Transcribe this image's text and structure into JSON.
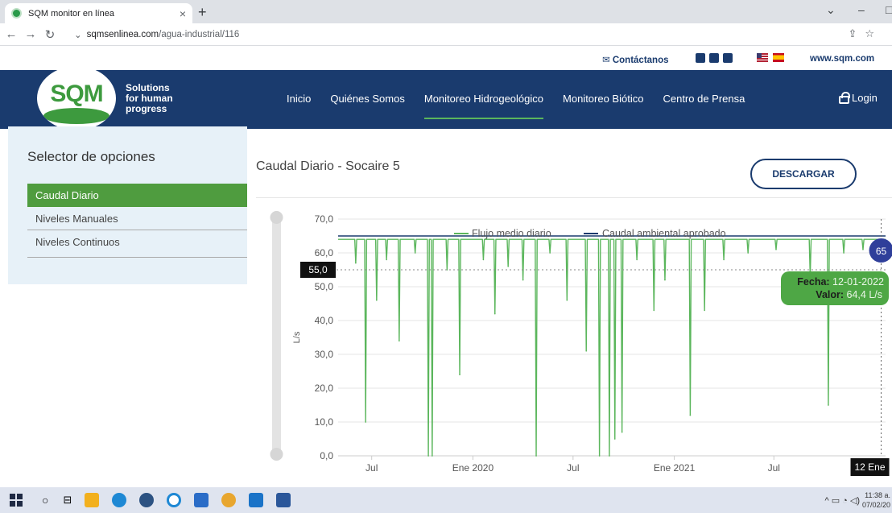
{
  "browser": {
    "tab_title": "SQM monitor en línea",
    "close_glyph": "×",
    "new_tab_glyph": "+",
    "url_host": "sqmsenlinea.com",
    "url_path": "/agua-industrial/116"
  },
  "topbar": {
    "contact": "Contáctanos",
    "website": "www.sqm.com"
  },
  "header": {
    "logo_text": "SQM",
    "tagline_1": "Solutions",
    "tagline_2": "for human",
    "tagline_3": "progress",
    "nav": [
      "Inicio",
      "Quiénes Somos",
      "Monitoreo Hidrogeológico",
      "Monitoreo Biótico",
      "Centro de Prensa"
    ],
    "login": "Login"
  },
  "sidebar": {
    "title": "Selector de opciones",
    "items": [
      "Caudal Diario",
      "Niveles Manuales",
      "Niveles Continuos"
    ]
  },
  "content": {
    "chart_title": "Caudal Diario - Socaire 5",
    "download_label": "DESCARGAR"
  },
  "chart_data": {
    "type": "line",
    "ylabel": "L/s",
    "y_ticks": [
      "70,0",
      "60,0",
      "50,0",
      "40,0",
      "30,0",
      "20,0",
      "10,0",
      "0,0"
    ],
    "ylim": [
      0,
      70
    ],
    "x_ticks": [
      "Jul",
      "Ene 2020",
      "Jul",
      "Ene 2021",
      "Jul"
    ],
    "xlim": [
      "2019-05-01",
      "2022-01-20"
    ],
    "x_hover_label": "12 Ene",
    "legend": [
      "Flujo medio diario",
      "Caudal ambiental aprobado"
    ],
    "legend_position": "top",
    "grid": true,
    "series": [
      {
        "name": "Flujo medio diario",
        "color": "#5bb65c",
        "baseline": 64,
        "drops": [
          {
            "date": "2019-06-02",
            "value": 57
          },
          {
            "date": "2019-06-20",
            "value": 10
          },
          {
            "date": "2019-07-10",
            "value": 46
          },
          {
            "date": "2019-07-28",
            "value": 58
          },
          {
            "date": "2019-08-20",
            "value": 34
          },
          {
            "date": "2019-09-18",
            "value": 60
          },
          {
            "date": "2019-10-12",
            "value": 0
          },
          {
            "date": "2019-10-19",
            "value": 0
          },
          {
            "date": "2019-11-15",
            "value": 55
          },
          {
            "date": "2019-12-08",
            "value": 24
          },
          {
            "date": "2020-01-20",
            "value": 58
          },
          {
            "date": "2020-02-10",
            "value": 42
          },
          {
            "date": "2020-03-05",
            "value": 56
          },
          {
            "date": "2020-04-01",
            "value": 52
          },
          {
            "date": "2020-04-25",
            "value": 0
          },
          {
            "date": "2020-05-20",
            "value": 60
          },
          {
            "date": "2020-06-20",
            "value": 46
          },
          {
            "date": "2020-07-25",
            "value": 31
          },
          {
            "date": "2020-08-18",
            "value": 0
          },
          {
            "date": "2020-09-05",
            "value": 0
          },
          {
            "date": "2020-09-15",
            "value": 5
          },
          {
            "date": "2020-09-28",
            "value": 7
          },
          {
            "date": "2020-10-25",
            "value": 58
          },
          {
            "date": "2020-11-25",
            "value": 43
          },
          {
            "date": "2020-12-15",
            "value": 52
          },
          {
            "date": "2021-01-30",
            "value": 12
          },
          {
            "date": "2021-02-25",
            "value": 43
          },
          {
            "date": "2021-04-01",
            "value": 58
          },
          {
            "date": "2021-05-15",
            "value": 60
          },
          {
            "date": "2021-07-05",
            "value": 61
          },
          {
            "date": "2021-09-05",
            "value": 53
          },
          {
            "date": "2021-10-08",
            "value": 15
          },
          {
            "date": "2021-11-05",
            "value": 60
          },
          {
            "date": "2021-12-10",
            "value": 61
          }
        ]
      },
      {
        "name": "Caudal ambiental aprobado",
        "color": "#1a3b6e",
        "value": 65
      }
    ],
    "navigator": {
      "selected_value": "55,0",
      "marker_value": "65"
    },
    "tooltip": {
      "date_label": "Fecha:",
      "date_value": "12-01-2022",
      "value_label": "Valor:",
      "value_value": "64,4 L/s",
      "hover_date": "2022-01-12",
      "hover_value": 64.4
    }
  },
  "taskbar": {
    "clock_time": "11:38 a.",
    "clock_date": "07/02/20"
  }
}
